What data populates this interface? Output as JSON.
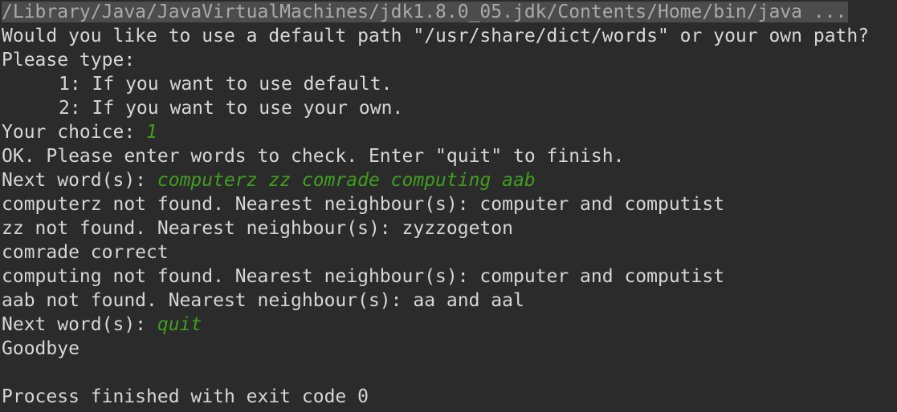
{
  "console": {
    "command_line": "/Library/Java/JavaVirtualMachines/jdk1.8.0_05.jdk/Contents/Home/bin/java ...",
    "prompt_path_question": "Would you like to use a default path \"/usr/share/dict/words\" or your own path?",
    "please_type": "Please type:",
    "option_1": "1: If you want to use default.",
    "option_2": "2: If you want to use your own.",
    "choice_label": "Your choice: ",
    "choice_input": "1",
    "ok_message": "OK. Please enter words to check. Enter \"quit\" to finish.",
    "next_word_label_1": "Next word(s): ",
    "next_word_input_1": "computerz zz comrade computing aab",
    "result_1": "computerz not found. Nearest neighbour(s): computer and computist",
    "result_2": "zz not found. Nearest neighbour(s): zyzzogeton",
    "result_3": "comrade correct",
    "result_4": "computing not found. Nearest neighbour(s): computer and computist",
    "result_5": "aab not found. Nearest neighbour(s): aa and aal",
    "next_word_label_2": "Next word(s): ",
    "next_word_input_2": "quit",
    "goodbye": "Goodbye",
    "exit_message": "Process finished with exit code 0"
  },
  "colors": {
    "background": "#2b2b2b",
    "text": "#d6d6d6",
    "user_input": "#3f9f1e",
    "command_highlight": "#4c4c4c"
  }
}
